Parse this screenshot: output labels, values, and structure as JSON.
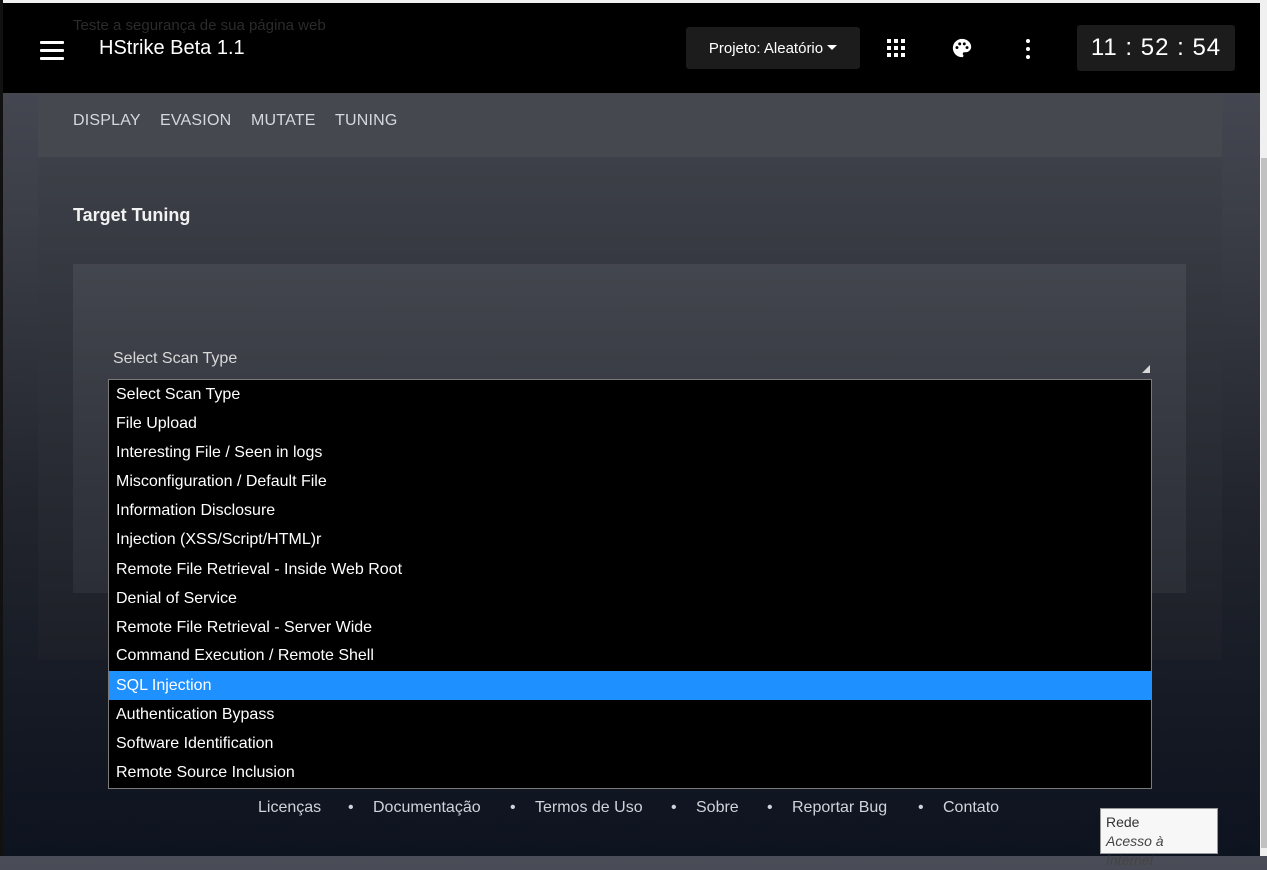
{
  "header": {
    "ghost_text": "Teste a segurança de sua página web",
    "app_title": "HStrike Beta 1.1",
    "project_button": "Projeto: Aleatório",
    "clock": "11 : 52 : 54",
    "icons": [
      "menu-icon",
      "apps-grid-icon",
      "palette-icon",
      "more-vert-icon"
    ]
  },
  "tabs": [
    "DISPLAY",
    "EVASION",
    "MUTATE",
    "TUNING"
  ],
  "section": {
    "title": "Target Tuning"
  },
  "select": {
    "label": "Select Scan Type",
    "options": [
      "Select Scan Type",
      "File Upload",
      "Interesting File / Seen in logs",
      "Misconfiguration / Default File",
      "Information Disclosure",
      "Injection (XSS/Script/HTML)r",
      "Remote File Retrieval - Inside Web Root",
      "Denial of Service",
      "Remote File Retrieval - Server Wide",
      "Command Execution / Remote Shell",
      "SQL Injection",
      "Authentication Bypass",
      "Software Identification",
      "Remote Source Inclusion"
    ],
    "highlighted": "SQL Injection",
    "highlight_color": "#1e90ff"
  },
  "footer": {
    "links": [
      "Licenças",
      "Documentação",
      "Termos de Uso",
      "Sobre",
      "Reportar Bug",
      "Contato"
    ],
    "separator": "•"
  },
  "tooltip": {
    "title": "Rede",
    "subtitle": "Acesso à Internet"
  }
}
